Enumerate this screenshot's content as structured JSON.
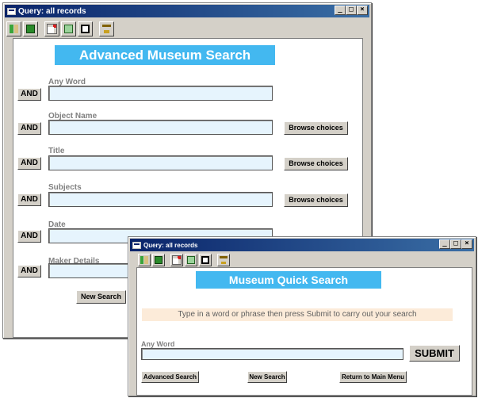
{
  "advanced_window": {
    "title": "Query: all records",
    "controls": [
      "_",
      "□",
      "×"
    ],
    "toolbar_icons": [
      "find-records-icon",
      "save-icon",
      "edit-icon",
      "layout-icon",
      "view-icon",
      "home-icon"
    ],
    "heading": "Advanced Museum Search",
    "fields": [
      {
        "label": "Any Word",
        "operator": "AND",
        "value": "",
        "browse": ""
      },
      {
        "label": "Object Name",
        "operator": "AND",
        "value": "",
        "browse": "Browse choices"
      },
      {
        "label": "Title",
        "operator": "AND",
        "value": "",
        "browse": "Browse choices"
      },
      {
        "label": "Subjects",
        "operator": "AND",
        "value": "",
        "browse": "Browse choices"
      },
      {
        "label": "Date",
        "operator": "AND",
        "value": "",
        "browse": ""
      },
      {
        "label": "Maker Details",
        "operator": "AND",
        "value": "",
        "browse": ""
      }
    ],
    "new_search_label": "New Search"
  },
  "quick_window": {
    "title": "Query: all records",
    "controls": [
      "_",
      "□",
      "×"
    ],
    "toolbar_icons": [
      "find-records-icon",
      "save-icon",
      "edit-icon",
      "layout-icon",
      "view-icon",
      "home-icon"
    ],
    "heading": "Museum Quick Search",
    "instruction": "Type in a word or phrase then press Submit to carry out your search",
    "any_word_label": "Any Word",
    "any_word_value": "",
    "submit_label": "SUBMIT",
    "advanced_search_label": "Advanced Search",
    "new_search_label": "New Search",
    "main_menu_label": "Return to Main Menu"
  },
  "colors": {
    "banner": "#43b8f0",
    "field_bg": "#e6f4fd",
    "instruction_bg": "#fcebd9",
    "title_bar": "#0a246a"
  }
}
